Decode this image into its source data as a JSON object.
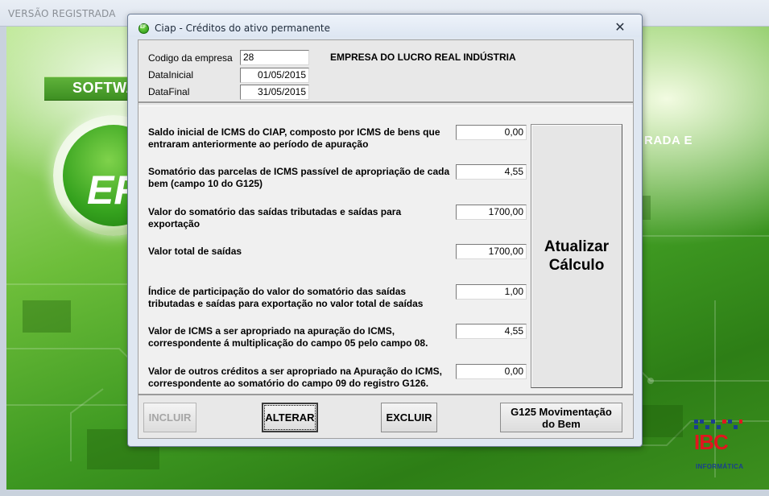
{
  "app": {
    "title": "VERSÃO REGISTRADA"
  },
  "background": {
    "software_label": "SOFTWA",
    "logo_letters": "EF",
    "right_caption": "RADA E",
    "ibc_text": "IBC",
    "ibc_subtitle": "INFORMÁTICA"
  },
  "dialog": {
    "title": "Ciap - Créditos do ativo permanente",
    "close_glyph": "✕",
    "header": {
      "codigo_label": "Codigo da empresa",
      "codigo_value": "28",
      "empresa_name": "EMPRESA DO LUCRO REAL INDÚSTRIA",
      "data_inicial_label": "DataInicial",
      "data_inicial_value": "01/05/2015",
      "data_final_label": "DataFinal",
      "data_final_value": "31/05/2015"
    },
    "fields": [
      {
        "label_1": "Saldo inicial de ICMS do CIAP, composto por ICMS de bens que",
        "label_2": "entraram anteriormente ao período de apuração",
        "value": "0,00"
      },
      {
        "label_1": "Somatório das parcelas de ICMS passível de apropriação de cada",
        "label_2": "bem (campo 10 do G125)",
        "value": "4,55"
      },
      {
        "label_1": "Valor do somatório das saídas tributadas e saídas para",
        "label_2": "exportação",
        "value": "1700,00"
      },
      {
        "label_1": "Valor total de saídas",
        "label_2": "",
        "value": "1700,00"
      },
      {
        "label_1": "Índice de participação do valor do somatório das saídas",
        "label_2": "tributadas e saídas para exportação no valor total de saídas",
        "value": "1,00"
      },
      {
        "label_1": "Valor de ICMS a ser apropriado na apuração do ICMS,",
        "label_2": "correspondente á multiplicação do campo 05 pelo campo 08.",
        "value": "4,55"
      },
      {
        "label_1": "Valor de outros créditos a ser apropriado na Apuração do ICMS,",
        "label_2": "correspondente ao somatório do campo 09 do registro G126.",
        "value": "0,00"
      }
    ],
    "atualizar_line1": "Atualizar",
    "atualizar_line2": "Cálculo",
    "buttons": {
      "incluir": "INCLUIR",
      "alterar": "ALTERAR",
      "excluir": "EXCLUIR",
      "g125_line1": "G125 Movimentação",
      "g125_line2": "do Bem"
    }
  },
  "colors": {
    "splash_green": "#3f9a22",
    "ibc_red": "#e0161e",
    "ibc_blue": "#1a3f8f"
  }
}
